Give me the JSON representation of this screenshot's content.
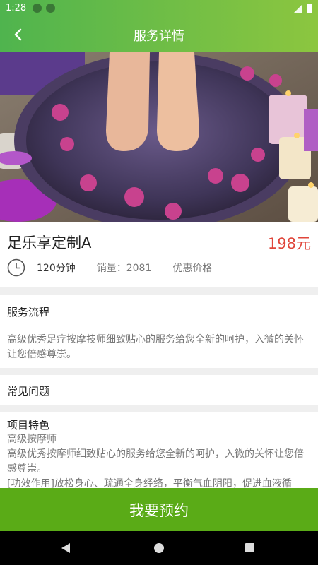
{
  "status_bar": {
    "time": "1:28"
  },
  "app_bar": {
    "title": "服务详情"
  },
  "product": {
    "name": "足乐享定制A",
    "price": "198元",
    "duration": "120分钟",
    "sales": "销量：2081",
    "promo": "优惠价格"
  },
  "sections": {
    "process_title": "服务流程",
    "process_text": "高级优秀足疗按摩技师细致贴心的服务给您全新的呵护，入微的关怀让您倍感尊崇。",
    "faq_title": "常见问题",
    "feature_title": "项目特色",
    "feature_lines": [
      "高级按摩师",
      "高级优秀按摩师细致贴心的服务给您全新的呵护，入微的关怀让您倍感尊崇。",
      "[功效作用]放松身心、疏通全身经络，平衡气血阴阳，促进血液循"
    ]
  },
  "book_button": "我要预约"
}
